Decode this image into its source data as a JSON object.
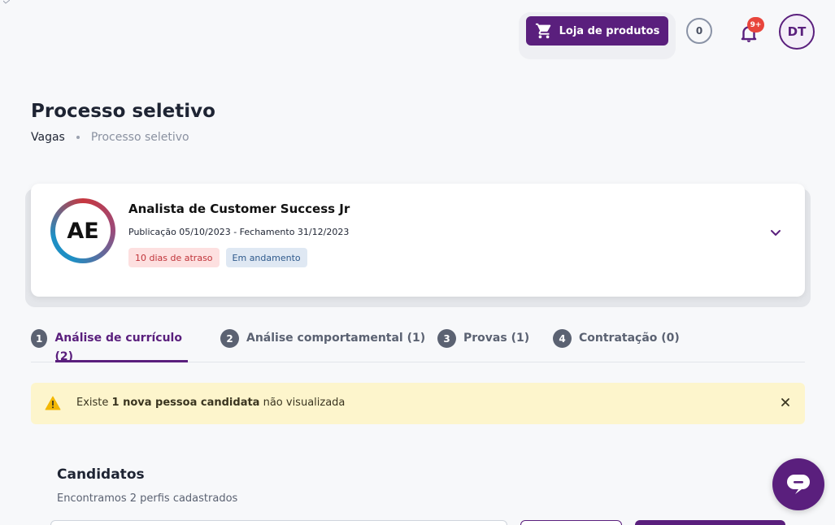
{
  "header": {
    "store_button_label": "Loja de produtos",
    "counter_value": "0",
    "notifications_badge": "9+",
    "avatar_initials": "DT"
  },
  "page": {
    "title": "Processo seletivo",
    "breadcrumb": [
      "Vagas",
      "Processo seletivo"
    ]
  },
  "job": {
    "logo_initials": "AE",
    "title": "Analista de Customer Success Jr",
    "dates": "Publicação 05/10/2023 - Fechamento 31/12/2023",
    "tag_late": "10 dias de atraso",
    "tag_status": "Em andamento"
  },
  "tabs": [
    {
      "num": "1",
      "label": "Análise de currículo (2)",
      "active": true
    },
    {
      "num": "2",
      "label": "Análise comportamental (1)",
      "active": false
    },
    {
      "num": "3",
      "label": "Provas (1)",
      "active": false
    },
    {
      "num": "4",
      "label": "Contratação (0)",
      "active": false
    }
  ],
  "alert": {
    "prefix": "Existe ",
    "bold": "1 nova pessoa candidata",
    "suffix": " não visualizada"
  },
  "candidates": {
    "title": "Candidatos",
    "subtitle": "Encontramos 2 perfis cadastrados"
  },
  "colors": {
    "brand": "#5a1f7d",
    "alert_bg": "#fdf5cc",
    "badge": "#e8453c"
  }
}
